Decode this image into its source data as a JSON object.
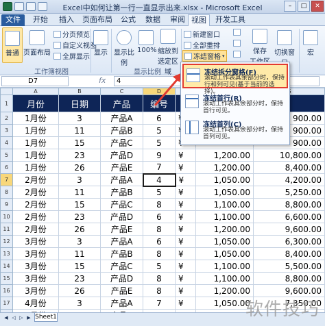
{
  "window": {
    "title": "Excel中如何让第一行一直显示出来.xlsx - Microsoft Excel"
  },
  "tabs": [
    "文件",
    "开始",
    "插入",
    "页面布局",
    "公式",
    "数据",
    "审阅",
    "视图",
    "开发工具"
  ],
  "ribbon": {
    "view_normal": "普通",
    "view_page_layout": "页面布局",
    "page_break_preview": "分页预览",
    "custom_views": "自定义视图",
    "full_screen": "全屏显示",
    "group_workbook_views": "工作簿视图",
    "show": "显示",
    "zoom": "显示比例",
    "zoom_100": "100%",
    "zoom_selection_1": "缩放到",
    "zoom_selection_2": "选定区域",
    "group_zoom": "显示比例",
    "new_window": "新建窗口",
    "arrange_all": "全部重排",
    "freeze_panes": "冻结窗格",
    "save_workspace_1": "保存",
    "save_workspace_2": "工作区",
    "switch_windows": "切换窗口",
    "macros": "宏"
  },
  "formula_bar": {
    "cell_ref": "D7",
    "fx": "fx",
    "value": "4"
  },
  "columns": [
    "A",
    "B",
    "C",
    "D",
    "E",
    "F",
    "G"
  ],
  "header_row": {
    "month": "月份",
    "day": "日期",
    "product": "产品",
    "number": "编号"
  },
  "rows": [
    {
      "n": "2",
      "a": "1月份",
      "b": "3",
      "c": "产品A",
      "d": "6",
      "e": "¥",
      "f": "",
      "g": "900.00"
    },
    {
      "n": "3",
      "a": "1月份",
      "b": "11",
      "c": "产品B",
      "d": "5",
      "e": "¥",
      "f": "",
      "g": "900.00"
    },
    {
      "n": "4",
      "a": "1月份",
      "b": "15",
      "c": "产品C",
      "d": "5",
      "e": "¥",
      "f": "",
      "g": "900.00"
    },
    {
      "n": "5",
      "a": "1月份",
      "b": "23",
      "c": "产品D",
      "d": "9",
      "e": "¥",
      "f": "1,200.00",
      "g": "10,800.00"
    },
    {
      "n": "6",
      "a": "1月份",
      "b": "26",
      "c": "产品E",
      "d": "7",
      "e": "¥",
      "f": "1,200.00",
      "g": "8,400.00"
    },
    {
      "n": "7",
      "a": "2月份",
      "b": "3",
      "c": "产品A",
      "d": "4",
      "e": "¥",
      "f": "1,050.00",
      "g": "4,200.00"
    },
    {
      "n": "8",
      "a": "2月份",
      "b": "11",
      "c": "产品B",
      "d": "5",
      "e": "¥",
      "f": "1,050.00",
      "g": "5,250.00"
    },
    {
      "n": "9",
      "a": "2月份",
      "b": "15",
      "c": "产品C",
      "d": "8",
      "e": "¥",
      "f": "1,100.00",
      "g": "8,800.00"
    },
    {
      "n": "10",
      "a": "2月份",
      "b": "23",
      "c": "产品D",
      "d": "6",
      "e": "¥",
      "f": "1,100.00",
      "g": "6,600.00"
    },
    {
      "n": "11",
      "a": "2月份",
      "b": "26",
      "c": "产品E",
      "d": "8",
      "e": "¥",
      "f": "1,200.00",
      "g": "9,600.00"
    },
    {
      "n": "12",
      "a": "3月份",
      "b": "3",
      "c": "产品A",
      "d": "6",
      "e": "¥",
      "f": "1,050.00",
      "g": "6,300.00"
    },
    {
      "n": "13",
      "a": "3月份",
      "b": "11",
      "c": "产品B",
      "d": "8",
      "e": "¥",
      "f": "1,050.00",
      "g": "8,400.00"
    },
    {
      "n": "14",
      "a": "3月份",
      "b": "15",
      "c": "产品C",
      "d": "5",
      "e": "¥",
      "f": "1,100.00",
      "g": "5,500.00"
    },
    {
      "n": "15",
      "a": "3月份",
      "b": "23",
      "c": "产品D",
      "d": "8",
      "e": "¥",
      "f": "1,100.00",
      "g": "8,800.00"
    },
    {
      "n": "16",
      "a": "3月份",
      "b": "26",
      "c": "产品E",
      "d": "8",
      "e": "¥",
      "f": "1,200.00",
      "g": "9,600.00"
    },
    {
      "n": "17",
      "a": "4月份",
      "b": "3",
      "c": "产品A",
      "d": "7",
      "e": "¥",
      "f": "1,050.00",
      "g": "7,350.00"
    },
    {
      "n": "18",
      "a": "4月份",
      "b": "11",
      "c": "产品B",
      "d": "8",
      "e": "¥",
      "f": "1,050.00",
      "g": "8,400.00"
    },
    {
      "n": "19",
      "a": "4月份",
      "b": "15",
      "c": "产品C",
      "d": "5",
      "e": "¥",
      "f": "1,100.00",
      "g": "5,500.00"
    }
  ],
  "freeze_menu": [
    {
      "title": "冻结拆分窗格(F)",
      "desc": "滚动工作表其余部分时，保持行和列可见(基于当前的选择)。"
    },
    {
      "title": "冻结首行(R)",
      "desc": "滚动工作表其余部分时，保持首行可见。"
    },
    {
      "title": "冻结首列(C)",
      "desc": "滚动工作表其余部分时，保持首列可见。"
    }
  ],
  "sheet_tab": "Sheet1",
  "watermark": "软件技巧",
  "colors": {
    "header_fill": "#0e2557",
    "highlight_border": "#e23b30",
    "arrow": "#e23b30"
  }
}
